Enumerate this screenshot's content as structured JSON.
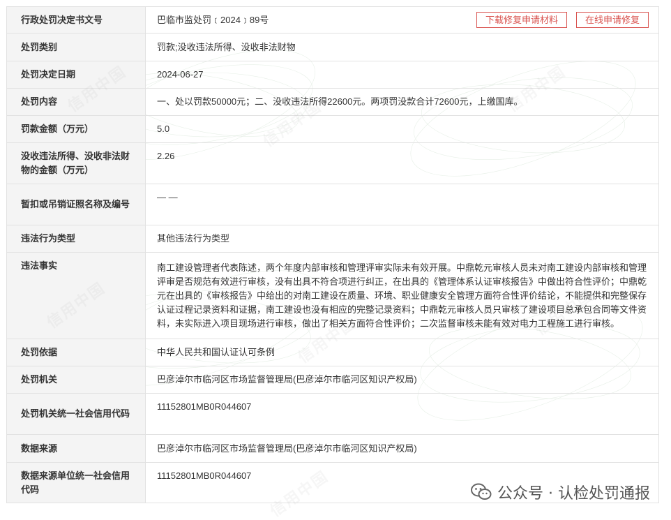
{
  "rows": [
    {
      "label": "行政处罚决定书文号",
      "value": "巴临市监处罚﹝2024﹞89号"
    },
    {
      "label": "处罚类别",
      "value": "罚款;没收违法所得、没收非法财物"
    },
    {
      "label": "处罚决定日期",
      "value": "2024-06-27"
    },
    {
      "label": "处罚内容",
      "value": "一、处以罚款50000元；二、没收违法所得22600元。两项罚没款合计72600元，上缴国库。"
    },
    {
      "label": "罚款金额（万元）",
      "value": "5.0"
    },
    {
      "label": "没收违法所得、没收非法财物的金额（万元）",
      "value": "2.26"
    },
    {
      "label": "暂扣或吊销证照名称及编号",
      "value": "— —"
    },
    {
      "label": "违法行为类型",
      "value": "其他违法行为类型"
    },
    {
      "label": "违法事实",
      "value": "南工建设管理者代表陈述，两个年度内部审核和管理评审实际未有效开展。中鼎乾元审核人员未对南工建设内部审核和管理评审是否规范有效进行审核，没有出具不符合项进行纠正，在出具的《管理体系认证审核报告》中做出符合性评价；中鼎乾元在出具的《审核报告》中给出的对南工建设在质量、环境、职业健康安全管理方面符合性评价结论，不能提供和完整保存认证过程记录资料和证据，南工建设也没有相应的完整记录资料；中鼎乾元审核人员只审核了建设项目总承包合同等文件资料，未实际进入项目现场进行审核，做出了相关方面符合性评价；二次监督审核未能有效对电力工程施工进行审核。"
    },
    {
      "label": "处罚依据",
      "value": "中华人民共和国认证认可条例"
    },
    {
      "label": "处罚机关",
      "value": "巴彦淖尔市临河区市场监督管理局(巴彦淖尔市临河区知识产权局)"
    },
    {
      "label": "处罚机关统一社会信用代码",
      "value": "11152801MB0R044607"
    },
    {
      "label": "数据来源",
      "value": "巴彦淖尔市临河区市场监督管理局(巴彦淖尔市临河区知识产权局)"
    },
    {
      "label": "数据来源单位统一社会信用代码",
      "value": "11152801MB0R044607"
    }
  ],
  "buttons": {
    "download": "下载修复申请材料",
    "online": "在线申请修复"
  },
  "watermark": {
    "text": "信用中国"
  },
  "badge": {
    "text": "公众号 · 认检处罚通报",
    "icon": "wechat-icon"
  },
  "colors": {
    "accent": "#d9534f",
    "label_bg": "#f4f4f4",
    "border": "#e2e2e2"
  }
}
